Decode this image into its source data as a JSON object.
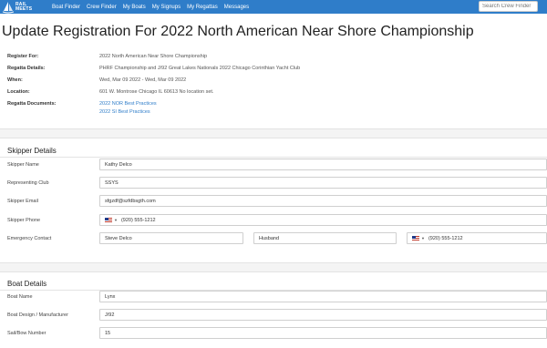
{
  "nav": {
    "logo_line1": "RAIL",
    "logo_line2": "MEETS",
    "links": [
      "Boat Finder",
      "Crew Finder",
      "My Boats",
      "My Signups",
      "My Regattas",
      "Messages"
    ],
    "search_placeholder": "Search Crew Finder"
  },
  "page": {
    "title": "Update Registration For 2022 North American Near Shore Championship"
  },
  "info": {
    "register_for": {
      "label": "Register For:",
      "value": "2022 North American Near Shore Championship"
    },
    "regatta_details": {
      "label": "Regatta Details:",
      "value": "PHRF Championship and J/92 Great Lakes Nationals 2022 Chicago Corinthian Yacht Club"
    },
    "when": {
      "label": "When:",
      "value": "Wed, Mar 09 2022 - Wed, Mar 09 2022"
    },
    "location": {
      "label": "Location:",
      "value": "601 W. Montrose Chicago IL 60613 No location set."
    },
    "documents": {
      "label": "Regatta Documents:",
      "links": [
        "2022 NOR Best Practices",
        "2022 SI Best Practices"
      ]
    }
  },
  "skipper": {
    "title": "Skipper Details",
    "name": {
      "label": "Skipper Name",
      "value": "Kathy Delco"
    },
    "club": {
      "label": "Representing Club",
      "value": "SSYS"
    },
    "email": {
      "label": "Skipper Email",
      "value": "sfgzdf@szfdbsgth.com"
    },
    "phone": {
      "label": "Skipper Phone",
      "value": "(920) 555-1212"
    },
    "emergency": {
      "label": "Emergency Contact",
      "name": "Steve Delco",
      "relation": "Husband",
      "phone": "(920) 555-1212"
    }
  },
  "boat": {
    "title": "Boat Details",
    "name": {
      "label": "Boat Name",
      "value": "Lynx"
    },
    "design": {
      "label": "Boat Design / Manufacturer",
      "value": "J/92"
    },
    "sail": {
      "label": "Sail/Bow Number",
      "value": "15"
    }
  }
}
